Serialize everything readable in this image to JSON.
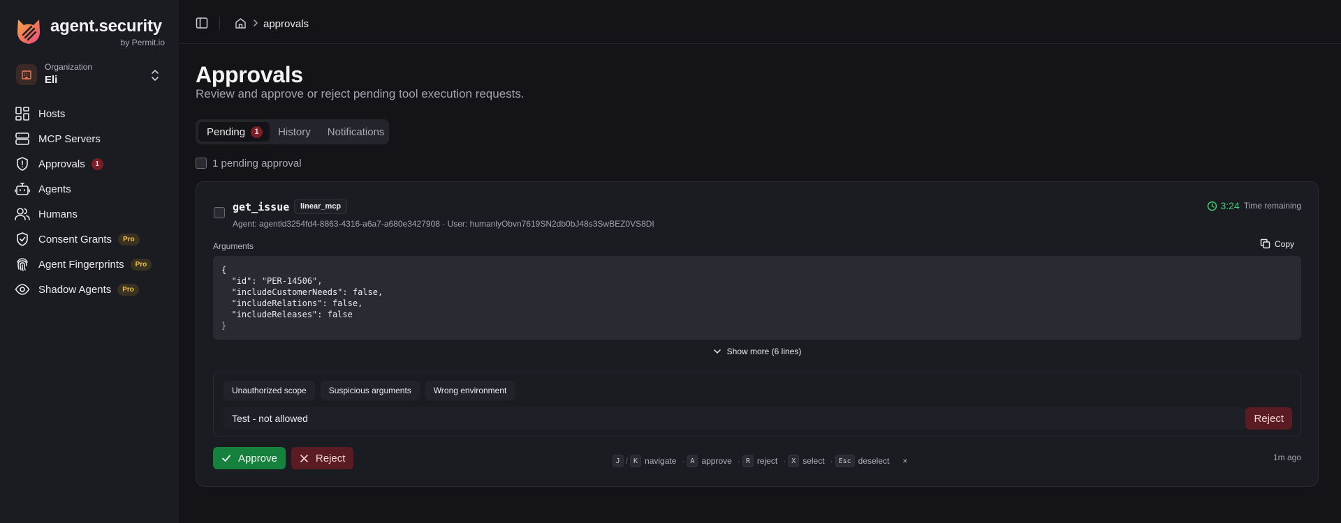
{
  "brand": {
    "name": "agent.security",
    "by": "by Permit.io",
    "accent": "#f47c5a"
  },
  "org": {
    "label": "Organization",
    "name": "Eli"
  },
  "sidebar": {
    "items": [
      {
        "label": "Hosts",
        "icon": "grid-icon"
      },
      {
        "label": "MCP Servers",
        "icon": "server-icon"
      },
      {
        "label": "Approvals",
        "icon": "shield-alert-icon",
        "badge": "1"
      },
      {
        "label": "Agents",
        "icon": "bot-icon"
      },
      {
        "label": "Humans",
        "icon": "users-icon"
      },
      {
        "label": "Consent Grants",
        "icon": "shield-check-icon",
        "badge": "Pro"
      },
      {
        "label": "Agent Fingerprints",
        "icon": "fingerprint-icon",
        "badge": "Pro"
      },
      {
        "label": "Shadow Agents",
        "icon": "eye-icon",
        "badge": "Pro"
      }
    ]
  },
  "breadcrumb": {
    "current": "approvals"
  },
  "page": {
    "title": "Approvals",
    "subtitle": "Review and approve or reject pending tool execution requests."
  },
  "tabs": [
    {
      "label": "Pending",
      "count": "1",
      "active": true
    },
    {
      "label": "History"
    },
    {
      "label": "Notifications"
    }
  ],
  "selection": {
    "label": "1 pending approval"
  },
  "request": {
    "tool": "get_issue",
    "server": "linear_mcp",
    "meta": "Agent: agentld3254fd4-8863-4316-a6a7-a680e3427908 · User: humanlyObvn7619SN2db0bJ48s3SwBEZ0VS8DI",
    "time_remaining_value": "3:24",
    "time_remaining_label": "Time remaining",
    "arguments_label": "Arguments",
    "copy_label": "Copy",
    "code_lines": [
      "{",
      "  \"id\": \"PER-14506\",",
      "  \"includeCustomerNeeds\": false,",
      "  \"includeRelations\": false,",
      "  \"includeReleases\": false",
      "}"
    ],
    "show_more_label": "Show more (6 lines)",
    "reject_reasons": [
      "Unauthorized scope",
      "Suspicious arguments",
      "Wrong environment"
    ],
    "reason_value": "Test - not allowed",
    "reject_small_label": "Reject",
    "approve_label": "Approve",
    "reject_label": "Reject",
    "ago": "1m ago"
  },
  "shortcuts": {
    "items": [
      {
        "keys": [
          "J",
          "K"
        ],
        "label": "navigate"
      },
      {
        "keys": [
          "A"
        ],
        "label": "approve"
      },
      {
        "keys": [
          "R"
        ],
        "label": "reject"
      },
      {
        "keys": [
          "X"
        ],
        "label": "select"
      },
      {
        "keys": [
          "Esc"
        ],
        "label": "deselect"
      }
    ],
    "close": "×"
  }
}
